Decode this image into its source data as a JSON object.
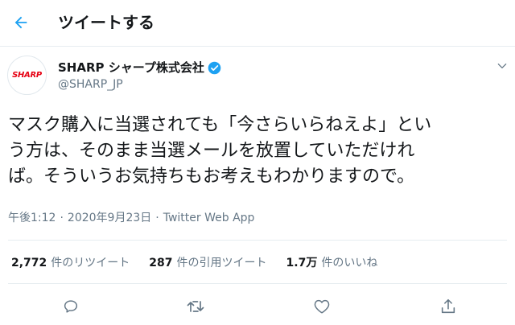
{
  "header": {
    "title": "ツイートする"
  },
  "user": {
    "display_name": "SHARP シャープ株式会社",
    "handle": "@SHARP_JP",
    "avatar_logo": "SHARP",
    "verified": true
  },
  "tweet": {
    "text_lines": [
      "マスク購入に当選されても「今さらいらねえよ」とい",
      "う方は、そのまま当選メールを放置していただけれ",
      "ば。そういうお気持ちもお考えもわかりますので。"
    ],
    "time": "午後1:12",
    "date": "2020年9月23日",
    "source": "Twitter Web App"
  },
  "stats": {
    "retweets": {
      "count": "2,772",
      "label": "件のリツイート"
    },
    "quotes": {
      "count": "287",
      "label": "件の引用ツイート"
    },
    "likes": {
      "count": "1.7万",
      "label": "件のいいね"
    }
  },
  "icons": {
    "back": "arrow-left-icon",
    "verified": "verified-badge-icon",
    "more": "chevron-down-icon",
    "reply": "reply-icon",
    "retweet": "retweet-icon",
    "like": "heart-icon",
    "share": "share-icon"
  },
  "colors": {
    "accent": "#1da1f2",
    "brand_red": "#e60012",
    "text_primary": "#14171a",
    "text_secondary": "#657786",
    "divider": "#e6ecf0"
  }
}
